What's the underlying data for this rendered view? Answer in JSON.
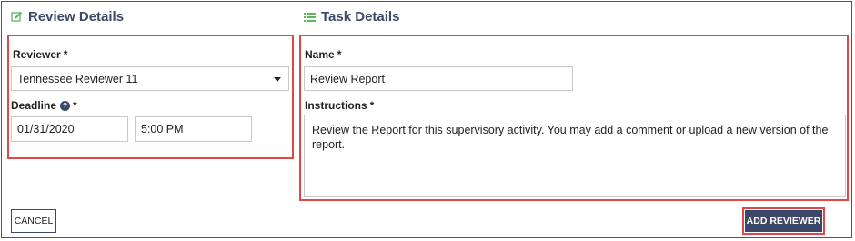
{
  "review_details": {
    "title": "Review Details",
    "reviewer_label": "Reviewer",
    "reviewer_required": "*",
    "reviewer_value": "Tennessee Reviewer 11",
    "deadline_label": "Deadline",
    "deadline_help": "?",
    "deadline_required": "*",
    "deadline_date": "01/31/2020",
    "deadline_time": "5:00 PM"
  },
  "task_details": {
    "title": "Task Details",
    "name_label": "Name",
    "name_required": "*",
    "name_value": "Review Report",
    "instructions_label": "Instructions",
    "instructions_required": "*",
    "instructions_value": "Review the Report for this supervisory activity. You may add a comment or upload a new version of the report."
  },
  "footer": {
    "cancel_label": "CANCEL",
    "add_reviewer_label": "ADD REVIEWER"
  },
  "colors": {
    "title": "#3a4a66",
    "icon_green": "#5cb85c",
    "highlight_red": "#e04848",
    "button_primary": "#3c4668"
  },
  "icons": {
    "review_details": "edit-icon",
    "task_details": "list-icon",
    "help": "help-icon",
    "select": "caret-down-icon"
  }
}
